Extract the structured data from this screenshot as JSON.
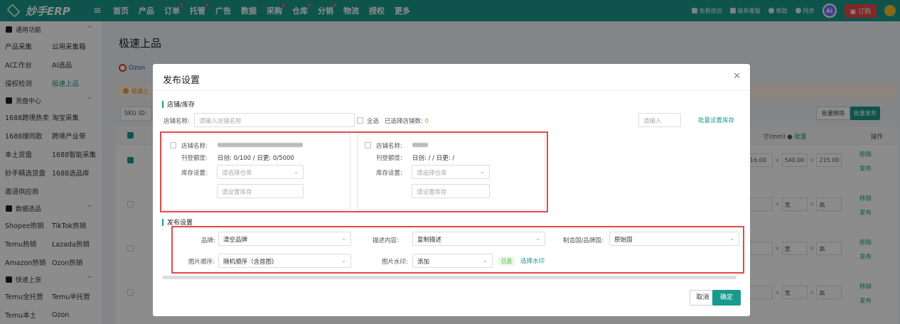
{
  "app": {
    "logo_text": "妙手ERP"
  },
  "nav": {
    "items": [
      {
        "label": "首页",
        "dot": false
      },
      {
        "label": "产品",
        "dot": false
      },
      {
        "label": "订单",
        "dot": true
      },
      {
        "label": "托管",
        "dot": true
      },
      {
        "label": "广告",
        "dot": false
      },
      {
        "label": "数据",
        "dot": false
      },
      {
        "label": "采购",
        "dot": true
      },
      {
        "label": "仓库",
        "dot": true
      },
      {
        "label": "分销",
        "dot": true
      },
      {
        "label": "物流",
        "dot": false
      },
      {
        "label": "授权",
        "dot": false
      },
      {
        "label": "更多",
        "dot": false
      }
    ],
    "right": {
      "training": "免费培训",
      "support": "联系客服",
      "help": "帮助",
      "sync": "同步",
      "ai": "Ai",
      "order": "订购"
    }
  },
  "sidebar": {
    "sections": [
      {
        "title": "通用功能",
        "rows": [
          [
            "产品采集",
            "公用采集箱"
          ],
          [
            "AI工作台",
            "AI选品"
          ],
          [
            "侵权检测",
            "极速上品"
          ]
        ]
      },
      {
        "title": "货盘中心",
        "rows": [
          [
            "1688跨境热卖",
            "淘宝采集"
          ],
          [
            "1688搜同款",
            "跨境产业带"
          ],
          [
            "本土货盘",
            "1688智能采集"
          ],
          [
            "妙手精选货盘",
            "1688选品库"
          ],
          [
            "邀请供应商",
            ""
          ]
        ]
      },
      {
        "title": "数据选品",
        "rows": [
          [
            "Shopee热销",
            "TikTok热销"
          ],
          [
            "Temu热销",
            "Lazada热销"
          ],
          [
            "Amazon热销",
            "Ozon热销"
          ]
        ]
      },
      {
        "title": "快速上货",
        "rows": [
          [
            "Temu全托管",
            "Temu半托管"
          ],
          [
            "Temu本土",
            "Ozon"
          ]
        ]
      }
    ],
    "active": "极速上品"
  },
  "page": {
    "title": "极速上品",
    "platform_tab": "Ozon",
    "tip": "极速上",
    "sku_label": "SKU ID:",
    "batch_remove": "批量移除",
    "batch_publish": "批量发布",
    "col_size": "寸(mm)",
    "col_size_link": "批量",
    "col_ops": "操作",
    "rows": [
      {
        "checked": true,
        "l": "16.00",
        "w": "540.00",
        "h": "215.00"
      },
      {
        "checked": false,
        "l": "",
        "w": "宽",
        "h": "高"
      },
      {
        "checked": false,
        "l": "",
        "w": "宽",
        "h": "高"
      },
      {
        "checked": false,
        "l": "",
        "w": "宽",
        "h": "高"
      }
    ],
    "op_remove": "移除",
    "op_publish": "发布"
  },
  "modal": {
    "title": "发布设置",
    "store_section": "店铺/库存",
    "store_name_label": "店铺名称:",
    "store_name_placeholder": "请输入店铺名称",
    "select_all": "全选",
    "selected_count_label": "已选择店铺数:",
    "selected_count": "0",
    "stock_input_placeholder": "请输入",
    "batch_stock_link": "批量设置库存",
    "cards": [
      {
        "name_label": "店铺名称:",
        "quota_label": "刊登额度:",
        "quota": "日创: 0/100 / 日更: 0/5000",
        "stock_label": "库存设置:",
        "warehouse_placeholder": "请选择仓库",
        "stock_placeholder": "请设置库存"
      },
      {
        "name_label": "店铺名称:",
        "quota_label": "刊登额度:",
        "quota": "日创: / / 日更: /",
        "stock_label": "库存设置:",
        "warehouse_placeholder": "请选择仓库",
        "stock_placeholder": "请设置库存"
      }
    ],
    "publish_section": "发布设置",
    "brand_label": "品牌:",
    "brand_value": "清空品牌",
    "desc_label": "描述内容:",
    "desc_value": "复制描述",
    "origin_label": "制造国/品牌国:",
    "origin_value": "原始国",
    "img_order_label": "图片顺序:",
    "img_order_value": "随机顺序（含首图)",
    "watermark_label": "图片水印:",
    "watermark_value": "添加",
    "watermark_tag": "已选",
    "watermark_link": "选择水印",
    "cancel": "取消",
    "confirm": "确定"
  }
}
